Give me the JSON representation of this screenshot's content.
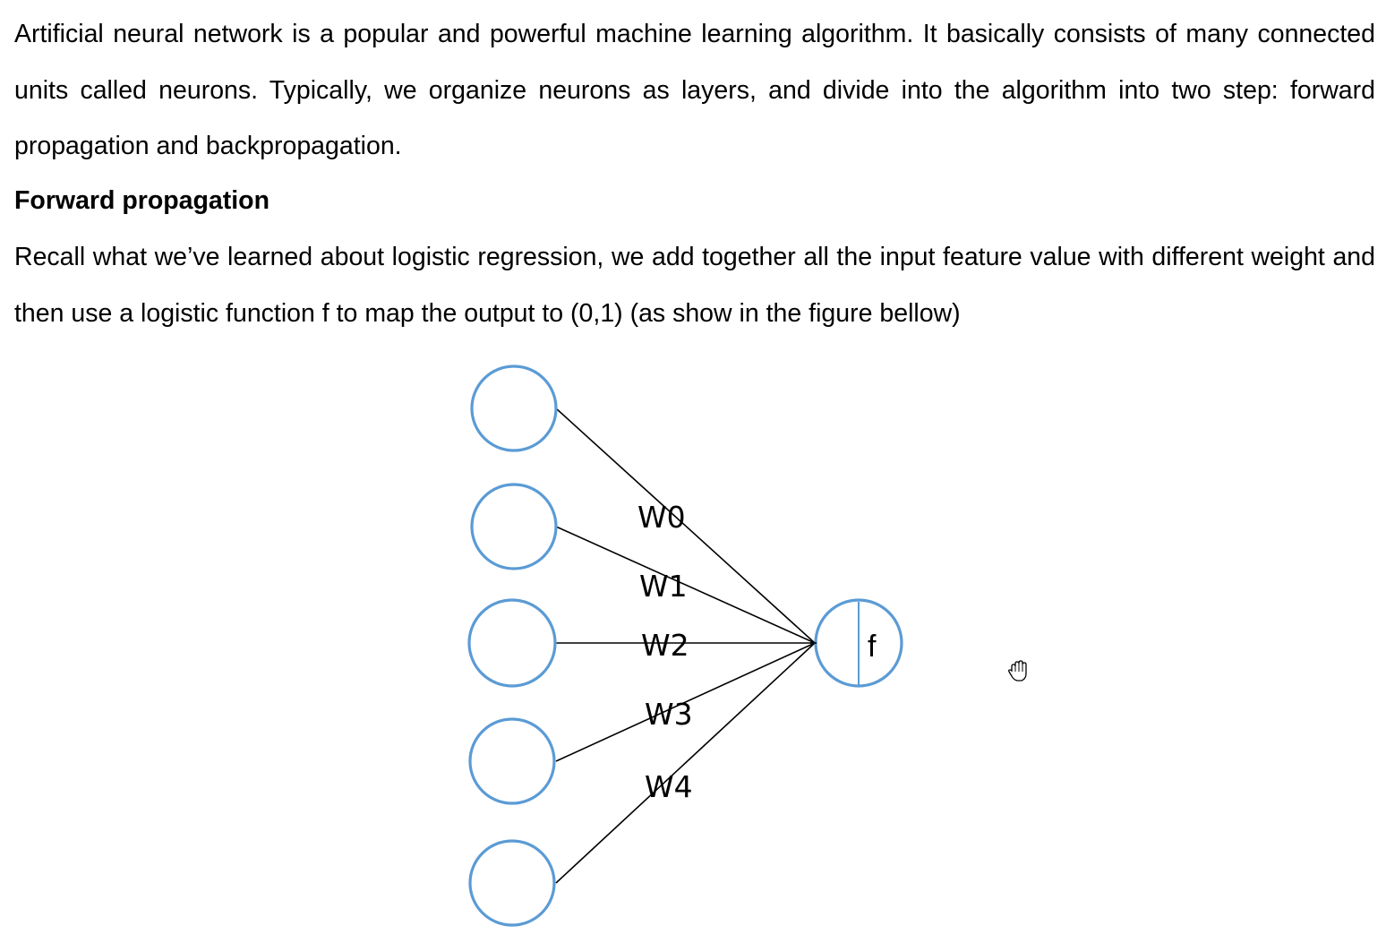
{
  "document": {
    "paragraph_1": "Artificial neural network is a popular and powerful machine learning algorithm. It basically consists of many connected units called neurons. Typically, we organize neurons as layers, and divide into the algorithm into two step: forward propagation and backpropagation.",
    "heading": "Forward propagation",
    "paragraph_2": "Recall what we’ve learned about logistic regression, we add together all the input feature value with different weight and then use a logistic function f to map the output to (0,1) (as show in the figure bellow)"
  },
  "figure": {
    "weights": [
      "W0",
      "W1",
      "W2",
      "W3",
      "W4"
    ],
    "output_label": "f",
    "node_color": "#5b9bd5"
  },
  "cursor": {
    "icon": "hand-cursor-icon"
  }
}
